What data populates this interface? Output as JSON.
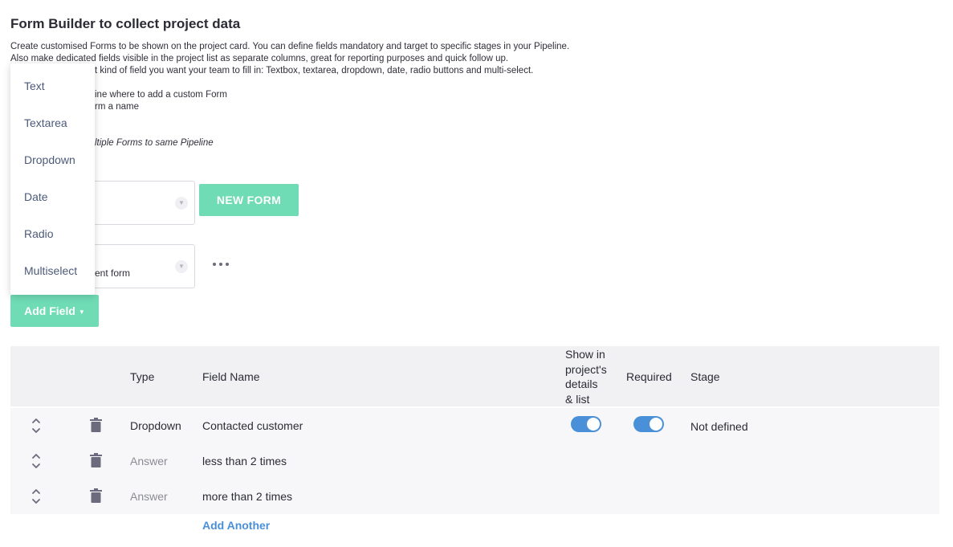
{
  "page": {
    "title": "Form Builder to collect project data",
    "description": [
      "Create customised Forms to be shown on the project card. You can define fields mandatory and target to specific stages in your Pipeline.",
      "Also make dedicated fields visible in the project list as separate columns, great for reporting purposes and quick follow up.",
      "t kind of field you want your team to fill in: Textbox, textarea, dropdown, date, radio buttons and multi-select.",
      "ine where to add a custom Form",
      "rm a name",
      "ltiple Forms to same Pipeline"
    ]
  },
  "pipeline_select": {
    "value": ""
  },
  "new_form_label": "NEW FORM",
  "form_select": {
    "value": "ent form"
  },
  "add_field": {
    "label": "Add Field"
  },
  "field_type_menu": [
    "Text",
    "Textarea",
    "Dropdown",
    "Date",
    "Radio",
    "Multiselect"
  ],
  "table": {
    "headers": {
      "type": "Type",
      "field_name": "Field Name",
      "show_in_list": [
        "Show in",
        "project's",
        "details",
        "& list"
      ],
      "required": "Required",
      "stage": "Stage"
    },
    "rows": [
      {
        "type": "Dropdown",
        "field_name": "Contacted customer",
        "show_in_list": true,
        "required": true,
        "stage": "Not defined"
      },
      {
        "type": "Answer",
        "field_name": "less than 2 times"
      },
      {
        "type": "Answer",
        "field_name": "more than 2 times"
      }
    ],
    "add_another": "Add Another"
  },
  "colors": {
    "accent_green": "#6fdcb6",
    "toggle_blue": "#4a90d9",
    "link_blue": "#4a90d9"
  }
}
